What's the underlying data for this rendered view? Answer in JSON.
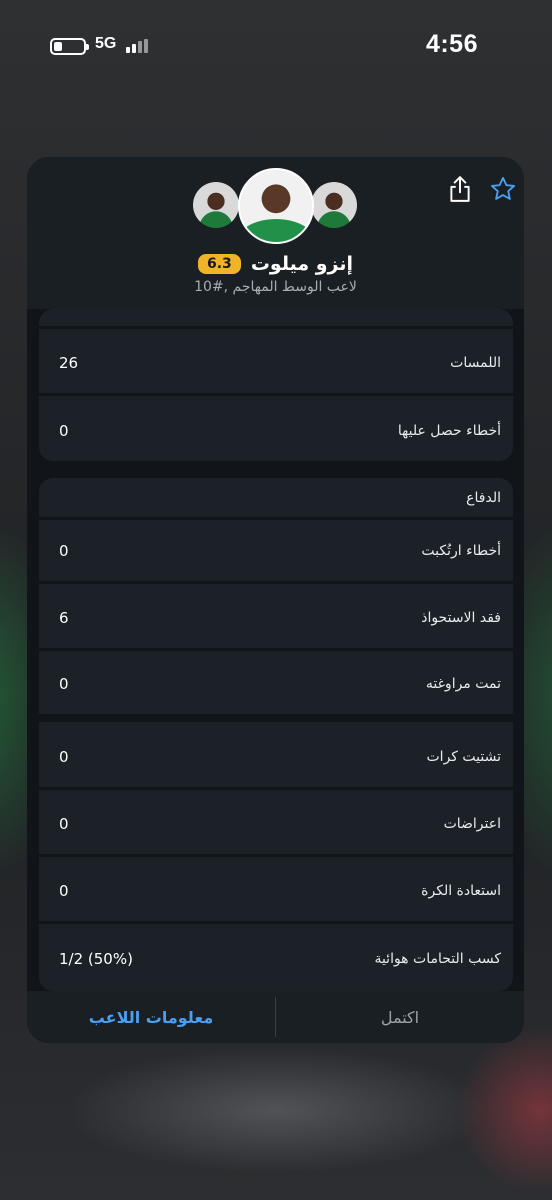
{
  "status_bar": {
    "time": "4:56",
    "network": "5G"
  },
  "header": {
    "player_name": "إنزو ميلوت",
    "rating": "6.3",
    "subtitle": "10#, لاعب الوسط المهاجم",
    "icons": [
      "star-icon",
      "share-icon"
    ],
    "accent_color": "#4a9ff0",
    "rating_color": "#f0b428"
  },
  "stats_top": [
    {
      "label": "اللمسات",
      "value": "26"
    },
    {
      "label": "أخطاء حصل عليها",
      "value": "0"
    }
  ],
  "defense": {
    "title": "الدفاع",
    "rows": [
      {
        "label": "أخطاء ارتُكبت",
        "value": "0"
      },
      {
        "label": "فقد الاستحواذ",
        "value": "6"
      },
      {
        "label": "تمت مراوغته",
        "value": "0"
      },
      {
        "label": "تشتيت كرات",
        "value": "0"
      },
      {
        "label": "اعتراضات",
        "value": "0"
      },
      {
        "label": "استعادة الكرة",
        "value": "0"
      },
      {
        "label": "كسب التحامات هوائية",
        "value": "1/2 (50%)"
      }
    ]
  },
  "footer": {
    "done_label": "اكتمل",
    "player_info_label": "معلومات اللاعب"
  }
}
